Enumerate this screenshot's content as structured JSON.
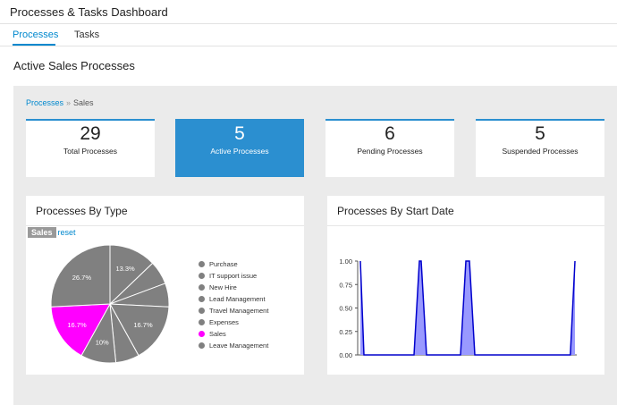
{
  "app_title": "Processes & Tasks Dashboard",
  "tabs": [
    {
      "label": "Processes"
    },
    {
      "label": "Tasks"
    }
  ],
  "section_title": "Active Sales Processes",
  "breadcrumb": {
    "link": "Processes",
    "separator": "»",
    "current": "Sales"
  },
  "cards": [
    {
      "value": "29",
      "label": "Total Processes"
    },
    {
      "value": "5",
      "label": "Active Processes"
    },
    {
      "value": "6",
      "label": "Pending Processes"
    },
    {
      "value": "5",
      "label": "Suspended Processes"
    }
  ],
  "colors": {
    "accent": "#2b8fd0",
    "link": "#0088ce",
    "pie_default": "#808080",
    "pie_selected": "#ff00ff",
    "area_stroke": "#0000cc",
    "area_fill": "#9999ff"
  },
  "pie_panel": {
    "title": "Processes By Type",
    "filter_chip": "Sales",
    "reset_label": "reset"
  },
  "area_panel": {
    "title": "Processes By Start Date"
  },
  "chart_data": [
    {
      "type": "pie",
      "title": "Processes By Type",
      "categories": [
        "Purchase",
        "IT support issue",
        "New Hire",
        "Lead Management",
        "Travel Management",
        "Expenses",
        "Sales",
        "Leave Management"
      ],
      "values": [
        13.3,
        6.7,
        6.7,
        16.7,
        6.7,
        10,
        16.7,
        26.7
      ],
      "slice_labels": [
        "13.3%",
        "",
        "",
        "16.7%",
        "",
        "10%",
        "16.7%",
        "26.7%"
      ],
      "highlighted": "Sales",
      "legend": "right"
    },
    {
      "type": "area",
      "title": "Processes By Start Date",
      "xlabel": "",
      "ylabel": "",
      "ylim": [
        0,
        1
      ],
      "y_ticks": [
        "1.00",
        "0.75",
        "0.50",
        "0.25",
        "0.00"
      ],
      "x": [
        0,
        1,
        2,
        10,
        11,
        12,
        22,
        23,
        24,
        34,
        35,
        36,
        46,
        47,
        48,
        58,
        59,
        60
      ],
      "values": [
        1,
        0,
        0,
        0,
        0,
        0,
        0,
        0,
        0,
        0,
        0,
        0,
        0,
        0,
        0,
        0,
        0,
        1
      ],
      "peaks": [
        {
          "x": [
            0,
            1
          ],
          "y": [
            1,
            0
          ]
        },
        {
          "x": [
            15,
            16.5,
            17,
            18.5
          ],
          "y": [
            0,
            1,
            1,
            0
          ]
        },
        {
          "x": [
            28,
            29.5,
            30.5,
            32
          ],
          "y": [
            0,
            1,
            1,
            0
          ]
        },
        {
          "x": [
            58.7,
            60
          ],
          "y": [
            0,
            1
          ]
        }
      ],
      "grid": false
    }
  ]
}
